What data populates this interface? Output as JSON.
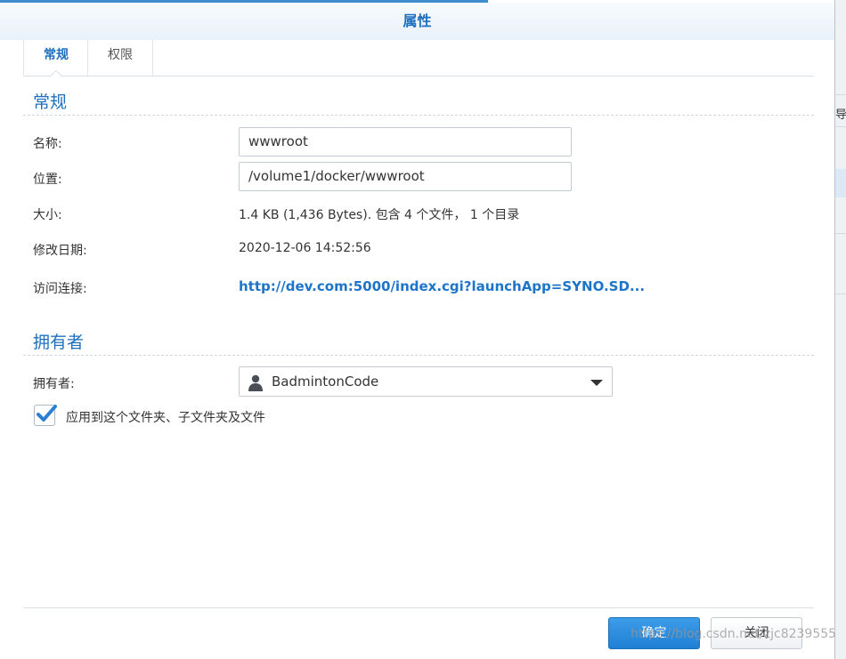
{
  "dialog": {
    "title": "属性"
  },
  "tabs": [
    {
      "label": "常规",
      "active": true
    },
    {
      "label": "权限",
      "active": false
    }
  ],
  "general": {
    "section_title": "常规",
    "name_label": "名称:",
    "name_value": "wwwroot",
    "location_label": "位置:",
    "location_value": "/volume1/docker/wwwroot",
    "size_label": "大小:",
    "size_value": "1.4 KB (1,436 Bytes). 包含 4 个文件， 1 个目录",
    "modified_label": "修改日期:",
    "modified_value": "2020-12-06 14:52:56",
    "link_label": "访问连接:",
    "link_value": "http://dev.com:5000/index.cgi?launchApp=SYNO.SD..."
  },
  "owner": {
    "section_title": "拥有者",
    "owner_label": "拥有者:",
    "owner_value": "BadmintonCode",
    "apply_label": "应用到这个文件夹、子文件夹及文件",
    "apply_checked": true
  },
  "buttons": {
    "ok": "确定",
    "cancel": "关闭"
  },
  "background": {
    "cut_text": "导出"
  },
  "watermark": "https://blog.csdn.net/zjc8239555",
  "colors": {
    "accent": "#1f6fbf",
    "link": "#1d74c9",
    "primary_button": "#1f7fd4"
  },
  "icons": {
    "owner": "user-icon",
    "dropdown": "chevron-down-icon",
    "checkbox": "checkmark-icon"
  }
}
